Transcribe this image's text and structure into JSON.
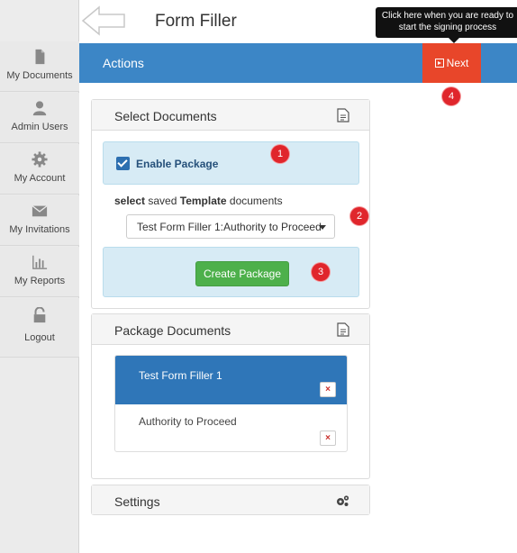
{
  "app": {
    "title": "Form Filler"
  },
  "sidebar": {
    "items": [
      {
        "label": "My Documents",
        "icon": "document-icon"
      },
      {
        "label": "Admin Users",
        "icon": "user-icon"
      },
      {
        "label": "My Account",
        "icon": "gear-icon"
      },
      {
        "label": "My Invitations",
        "icon": "envelope-icon"
      },
      {
        "label": "My Reports",
        "icon": "bar-chart-icon"
      },
      {
        "label": "Logout",
        "icon": "unlock-icon"
      }
    ]
  },
  "tooltip": {
    "line1": "Click here when you are ready to",
    "line2": "start the signing process"
  },
  "actions": {
    "label": "Actions",
    "next_label": "Next"
  },
  "select_documents": {
    "title": "Select Documents",
    "enable_package_label": "Enable Package",
    "enable_package_checked": true,
    "select_prefix": "select",
    "select_mid": "saved",
    "select_bold": "Template",
    "select_suffix": "documents",
    "template_value": "Test Form Filler 1:Authority to Proceed",
    "create_package_label": "Create Package"
  },
  "package_documents": {
    "title": "Package Documents",
    "items": [
      {
        "name": "Test Form Filler 1",
        "delete": "×"
      },
      {
        "name": "Authority to Proceed",
        "delete": "×"
      }
    ]
  },
  "settings": {
    "title": "Settings"
  },
  "badges": [
    "1",
    "2",
    "3",
    "4"
  ],
  "colors": {
    "accent": "#3c86c6",
    "next": "#e8462a",
    "success": "#4db04b",
    "badge": "#e0262c",
    "info_bg": "#d7ebf5"
  }
}
